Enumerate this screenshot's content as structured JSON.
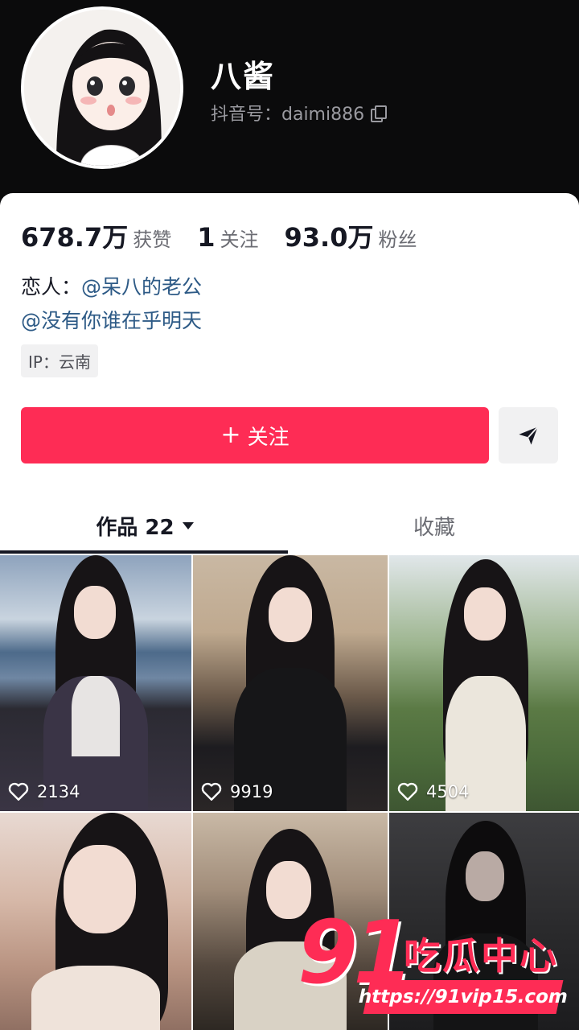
{
  "profile": {
    "nickname": "八酱",
    "douyin_id": "抖音号：daimi886"
  },
  "stats": [
    {
      "num": "678.7万",
      "label": "获赞"
    },
    {
      "num": "1",
      "label": "关注"
    },
    {
      "num": "93.0万",
      "label": "粉丝"
    }
  ],
  "bio": {
    "line1_prefix": "恋人：",
    "line1_mention": "@呆八的老公",
    "line2_mention": "@没有你谁在乎明天"
  },
  "ip_tag": "IP：云南",
  "follow_button": {
    "label": "关注",
    "icon": "plus-icon"
  },
  "share_button": {
    "icon": "send-icon"
  },
  "tabs": {
    "works": "作品 22",
    "favorites": "收藏"
  },
  "videos": [
    {
      "likes": "2134"
    },
    {
      "likes": "9919"
    },
    {
      "likes": "4504"
    },
    {
      "likes": ""
    },
    {
      "likes": ""
    },
    {
      "likes": ""
    }
  ],
  "watermark": {
    "number": "91",
    "text": "吃瓜中心",
    "url": "https://91vip15.com"
  },
  "colors": {
    "accent": "#fe2c55",
    "mention": "#2d5a86",
    "header_bg": "#0b0b0c"
  }
}
